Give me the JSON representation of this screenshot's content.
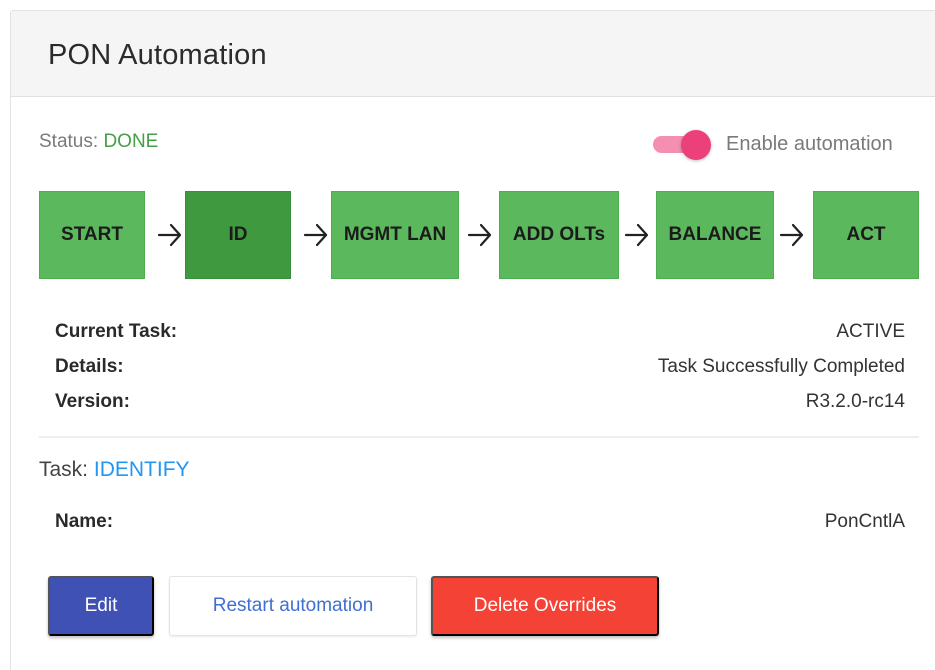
{
  "card": {
    "title": "PON Automation"
  },
  "status": {
    "label": "Status:",
    "value": "DONE"
  },
  "automation_toggle": {
    "label": "Enable automation",
    "enabled": true
  },
  "pipeline": {
    "steps": [
      {
        "label": "START",
        "current": false
      },
      {
        "label": "ID",
        "current": true
      },
      {
        "label": "MGMT LAN",
        "current": false
      },
      {
        "label": "ADD OLTs",
        "current": false
      },
      {
        "label": "BALANCE",
        "current": false
      },
      {
        "label": "ACT",
        "current": false
      }
    ]
  },
  "details": {
    "current_task_label": "Current Task:",
    "current_task_value": "ACTIVE",
    "details_label": "Details:",
    "details_value": "Task Successfully Completed",
    "version_label": "Version:",
    "version_value": "R3.2.0-rc14"
  },
  "task": {
    "label": "Task:",
    "value": "IDENTIFY",
    "name_label": "Name:",
    "name_value": "PonCntlA"
  },
  "buttons": {
    "edit": "Edit",
    "restart": "Restart automation",
    "delete": "Delete Overrides"
  },
  "colors": {
    "step_done": "#5cb85c",
    "step_current": "#3f9a3f",
    "status_done": "#43a047",
    "task_link": "#2196f3",
    "edit_button": "#3f51b5",
    "delete_button": "#f44336",
    "toggle_on": "#ec407a"
  }
}
